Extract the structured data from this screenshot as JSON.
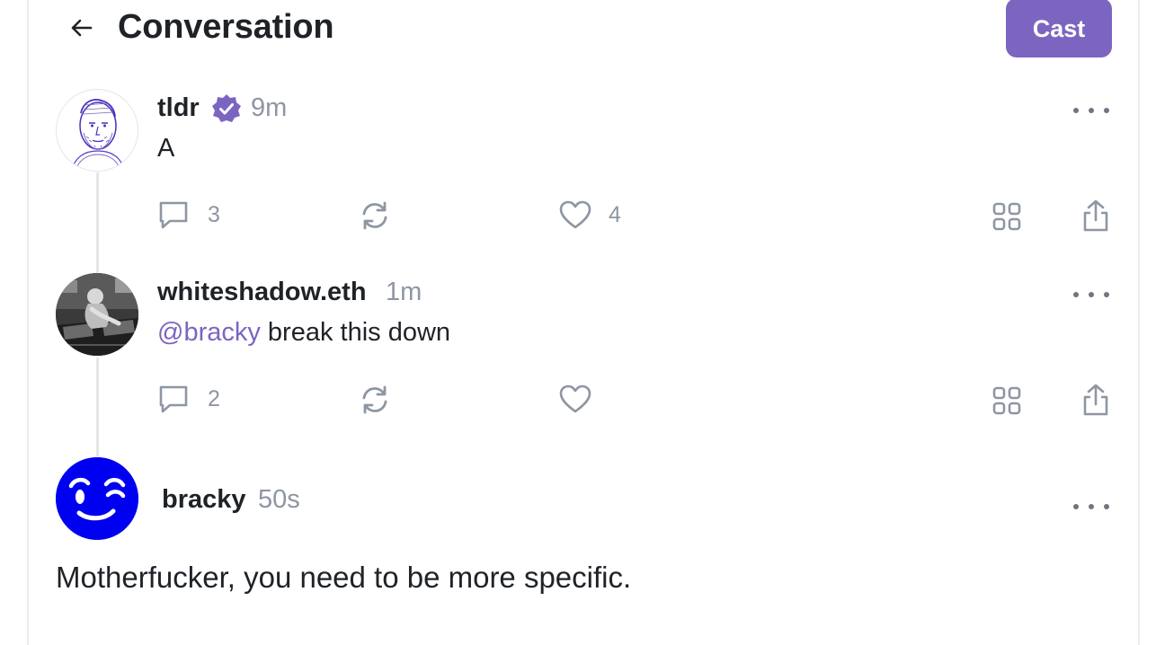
{
  "header": {
    "title": "Conversation",
    "cast_label": "Cast",
    "back_icon": "arrow-left-icon"
  },
  "posts": [
    {
      "name": "tldr",
      "verified": true,
      "time": "9m",
      "text": "A",
      "replies": "3",
      "likes": "4"
    },
    {
      "name": "whiteshadow.eth",
      "time": "1m",
      "mention": "@bracky",
      "text": " break this down",
      "replies": "2",
      "likes": ""
    },
    {
      "name": "bracky",
      "time": "50s",
      "text": "Motherfucker, you need to be more specific."
    }
  ],
  "colors": {
    "accent": "#7c65c1",
    "muted": "#8e96a3",
    "bracky_blue": "#0000f0"
  }
}
